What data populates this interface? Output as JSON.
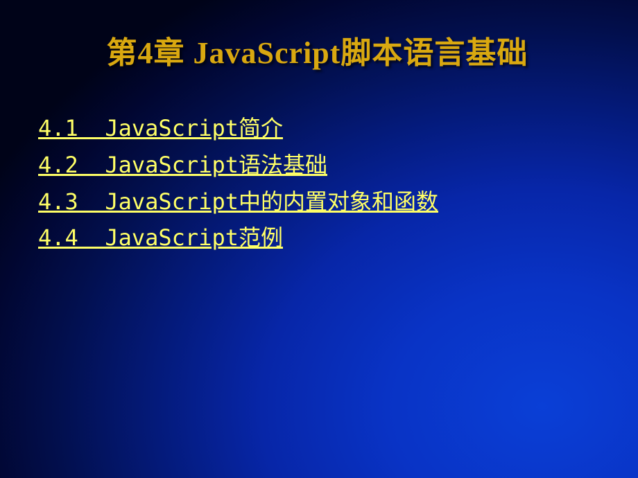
{
  "slide": {
    "title": "第4章 JavaScript脚本语言基础",
    "toc": [
      {
        "label": "4.1  JavaScript简介"
      },
      {
        "label": "4.2  JavaScript语法基础"
      },
      {
        "label": "4.3  JavaScript中的内置对象和函数"
      },
      {
        "label": "4.4  JavaScript范例"
      }
    ]
  }
}
